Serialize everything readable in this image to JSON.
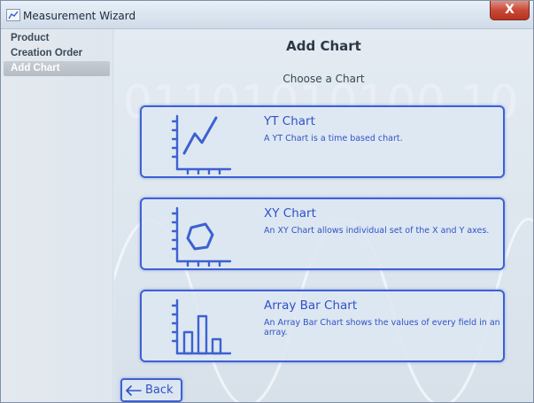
{
  "window": {
    "title": "Measurement Wizard",
    "close_label": "X"
  },
  "sidebar": {
    "items": [
      {
        "label": "Product"
      },
      {
        "label": "Creation Order"
      },
      {
        "label": "Add Chart"
      }
    ]
  },
  "main": {
    "title": "Add Chart",
    "subtitle": "Choose a Chart",
    "background_digits": "01101010100  10",
    "cards": [
      {
        "title": "YT Chart",
        "description": "A YT Chart is a time based chart.",
        "icon": "yt-chart-icon"
      },
      {
        "title": "XY Chart",
        "description": "An XY Chart allows individual set of the X and Y axes.",
        "icon": "xy-chart-icon"
      },
      {
        "title": "Array Bar Chart",
        "description": "An Array Bar Chart shows the values of every field in an array.",
        "icon": "array-bar-chart-icon"
      }
    ],
    "back_label": "Back"
  },
  "colors": {
    "accent": "#3d61d2",
    "text_accent": "#2f52c8",
    "close": "#c84a36"
  }
}
